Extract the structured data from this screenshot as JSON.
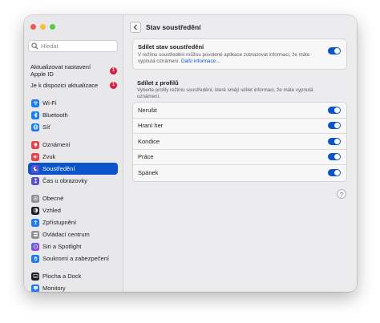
{
  "sidebar": {
    "search_placeholder": "Hledat",
    "alerts": [
      {
        "label": "Aktualizovat nastavení Apple ID",
        "badge": "1"
      },
      {
        "label": "Je k dispozici aktualizace",
        "badge": "1"
      }
    ],
    "items": [
      {
        "label": "Wi-Fi",
        "icon": "wifi-icon",
        "color": "#1a7cf0"
      },
      {
        "label": "Bluetooth",
        "icon": "bluetooth-icon",
        "color": "#1a7cf0"
      },
      {
        "label": "Síť",
        "icon": "globe-icon",
        "color": "#1a7cf0"
      },
      {
        "label": "Oznámení",
        "icon": "bell-icon",
        "color": "#e8424a"
      },
      {
        "label": "Zvuk",
        "icon": "speaker-icon",
        "color": "#e8424a"
      },
      {
        "label": "Soustředění",
        "icon": "moon-icon",
        "color": "#5b4fd0"
      },
      {
        "label": "Čas u obrazovky",
        "icon": "hourglass-icon",
        "color": "#5b4fd0"
      },
      {
        "label": "Obecné",
        "icon": "gear-icon",
        "color": "#8e8e93"
      },
      {
        "label": "Vzhled",
        "icon": "appearance-icon",
        "color": "#1d1d1f"
      },
      {
        "label": "Zpřístupnění",
        "icon": "accessibility-icon",
        "color": "#1a7cf0"
      },
      {
        "label": "Ovládací centrum",
        "icon": "control-center-icon",
        "color": "#8e8e93"
      },
      {
        "label": "Siri a Spotlight",
        "icon": "siri-icon",
        "color": "#b040d0"
      },
      {
        "label": "Soukromí a zabezpečení",
        "icon": "hand-icon",
        "color": "#1a7cf0"
      },
      {
        "label": "Plocha a Dock",
        "icon": "dock-icon",
        "color": "#1d1d1f"
      },
      {
        "label": "Monitory",
        "icon": "display-icon",
        "color": "#1a7cf0"
      }
    ]
  },
  "main": {
    "title": "Stav soustředění",
    "share_card": {
      "label": "Sdílet stav soustředění",
      "desc": "V režimu soustředění můžou povolené aplikace zobrazovat informaci, že máte vypnutá oznámení.",
      "link": "Další informace…",
      "enabled": true
    },
    "profiles_section": {
      "title": "Sdílet z profilů",
      "desc": "Vyberte profily režimu soustředění, které smějí sdílet informaci, že máte vypnutá oznámení."
    },
    "profiles": [
      {
        "label": "Nerušit",
        "enabled": true
      },
      {
        "label": "Hraní her",
        "enabled": true
      },
      {
        "label": "Kondice",
        "enabled": true
      },
      {
        "label": "Práce",
        "enabled": true
      },
      {
        "label": "Spánek",
        "enabled": true
      }
    ],
    "help_label": "?"
  },
  "colors": {
    "accent": "#0b54c9",
    "badge": "#d81e3a"
  }
}
